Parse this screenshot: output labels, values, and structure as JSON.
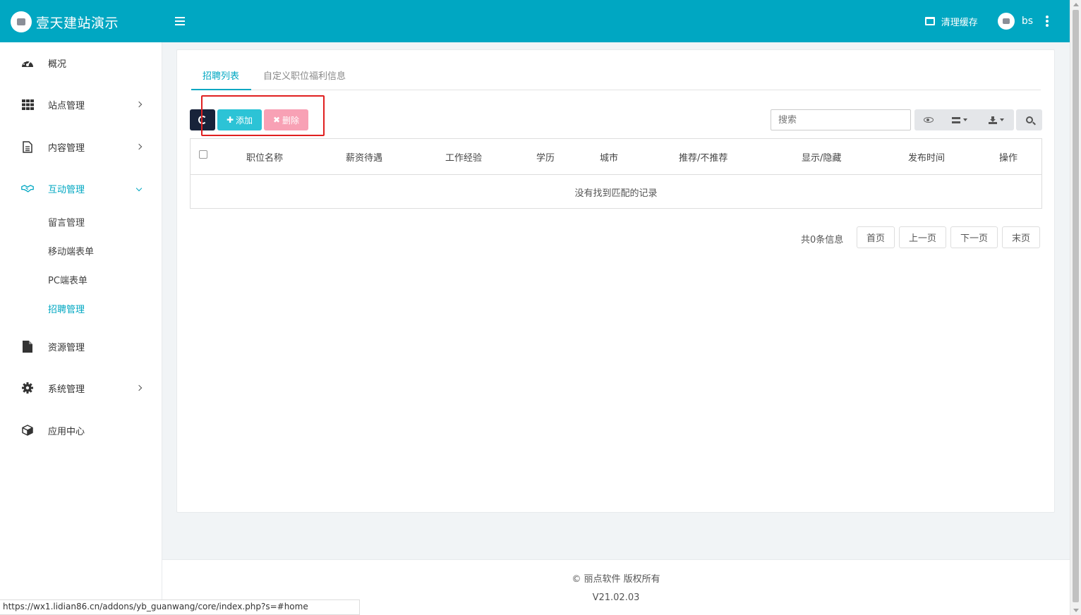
{
  "app": {
    "title": "壹天建站演示"
  },
  "header": {
    "clear_cache": "清理缓存",
    "username": "bs"
  },
  "sidebar": {
    "items": [
      {
        "label": "概况",
        "icon": "dashboard-icon"
      },
      {
        "label": "站点管理",
        "icon": "grid-icon"
      },
      {
        "label": "内容管理",
        "icon": "document-icon"
      },
      {
        "label": "互动管理",
        "icon": "handshake-icon",
        "active": true
      },
      {
        "label": "资源管理",
        "icon": "file-icon"
      },
      {
        "label": "系统管理",
        "icon": "gear-icon"
      },
      {
        "label": "应用中心",
        "icon": "cube-icon"
      }
    ],
    "sub_items": [
      {
        "label": "留言管理"
      },
      {
        "label": "移动端表单"
      },
      {
        "label": "PC端表单"
      },
      {
        "label": "招聘管理",
        "active": true
      }
    ]
  },
  "tabs": [
    {
      "label": "招聘列表",
      "active": true
    },
    {
      "label": "自定义职位福利信息"
    }
  ],
  "toolbar": {
    "add_label": "添加",
    "delete_label": "删除",
    "search_placeholder": "搜索"
  },
  "table": {
    "columns": [
      "职位名称",
      "薪资待遇",
      "工作经验",
      "学历",
      "城市",
      "推荐/不推荐",
      "显示/隐藏",
      "发布时间",
      "操作"
    ],
    "empty_text": "没有找到匹配的记录"
  },
  "pagination": {
    "total_text": "共0条信息",
    "first": "首页",
    "prev": "上一页",
    "next": "下一页",
    "last": "末页"
  },
  "footer": {
    "copyright": "© 丽点软件 版权所有",
    "version": "V21.02.03"
  },
  "statusbar": {
    "url": "https://wx1.lidian86.cn/addons/yb_guanwang/core/index.php?s=#home"
  },
  "colors": {
    "accent": "#00a7c2",
    "add": "#2cc3d6",
    "delete": "#f8a1b5",
    "refresh": "#18233a"
  }
}
